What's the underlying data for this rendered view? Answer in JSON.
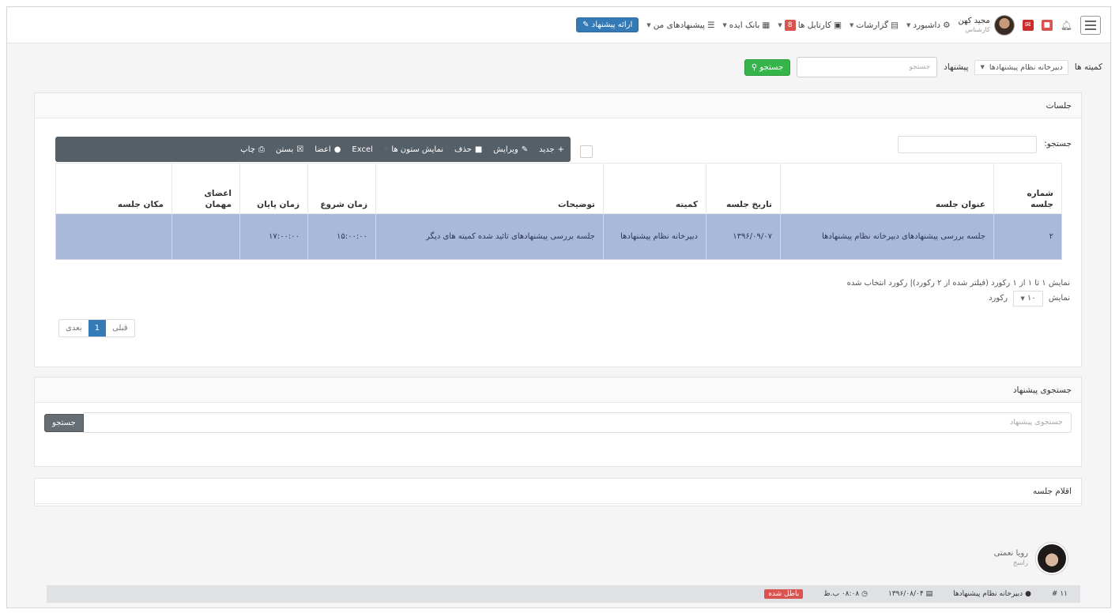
{
  "navbar": {
    "menu_icon": "hamburger-icon",
    "bell_icon": "bell-icon",
    "badge_alert": "",
    "user_name": "مجید کهن",
    "user_role": "کارشناس",
    "dashboard": "داشبورد",
    "reports": "گزارشات",
    "cartable": "کارتابل ها",
    "cartable_count": "8",
    "idea_bank": "بانک ایده",
    "my_suggestions": "پیشنهادهای من",
    "submit_suggestion": "ارائه پیشنهاد"
  },
  "breadcrumb": {
    "committees_label": "کمیته ها",
    "committee_value": "دبیرخانه نظام پیشنهادها",
    "suggestion_label": "پیشنهاد",
    "search_placeholder": "جستجو",
    "search_button": "جستجو"
  },
  "sessions": {
    "title": "جلسات",
    "search_label": "جستجو:",
    "toolbar": {
      "new": "جدید",
      "edit": "ویرایش",
      "delete": "حذف",
      "columns": "نمایش ستون ها",
      "excel": "Excel",
      "members": "اعضا",
      "close": "بستن",
      "print": "چاپ"
    },
    "headers": {
      "number": "شماره جلسه",
      "title": "عنوان جلسه",
      "date": "تاریخ جلسه",
      "committee": "کمیته",
      "description": "توضیحات",
      "start": "زمان شروع",
      "end": "زمان پایان",
      "guests": "اعضای مهمان",
      "location": "مکان جلسه"
    },
    "rows": [
      {
        "number": "۲",
        "title": "جلسه بررسی پیشنهادهای دبیرخانه نظام پیشنهادها",
        "date": "۱۳۹۶/۰۹/۰۷",
        "committee": "دبیرخانه نظام پیشنهادها",
        "description": "جلسه بررسی پیشنهادهای تائید شده کمیته های دیگر",
        "start": "۱۵:۰۰:۰۰",
        "end": "۱۷:۰۰:۰۰",
        "guests": "",
        "location": ""
      }
    ],
    "info_line": "نمایش ۱ تا ۱ از ۱ رکورد (فیلتر شده از ۲ رکورد)| رکورد انتخاب شده",
    "show_label": "نمایش",
    "page_size": "۱۰",
    "records_label": "رکورد",
    "pager": {
      "prev": "قبلی",
      "current": "1",
      "next": "بعدی"
    }
  },
  "suggestion_search": {
    "title": "جستجوی پیشنهاد",
    "placeholder": "جستجوی پیشنهاد",
    "button": "جستجو"
  },
  "session_items": {
    "title": "اقلام جلسه",
    "person_name": "رویا نعمتی",
    "person_role": "راسخ",
    "item": {
      "number": "۱۱ #",
      "committee": "دبیرخانه نظام پیشنهادها",
      "date": "۱۳۹۶/۰۸/۰۴",
      "time": "۰۸:۰۸ ب.ظ",
      "status": "باطل شده"
    }
  }
}
